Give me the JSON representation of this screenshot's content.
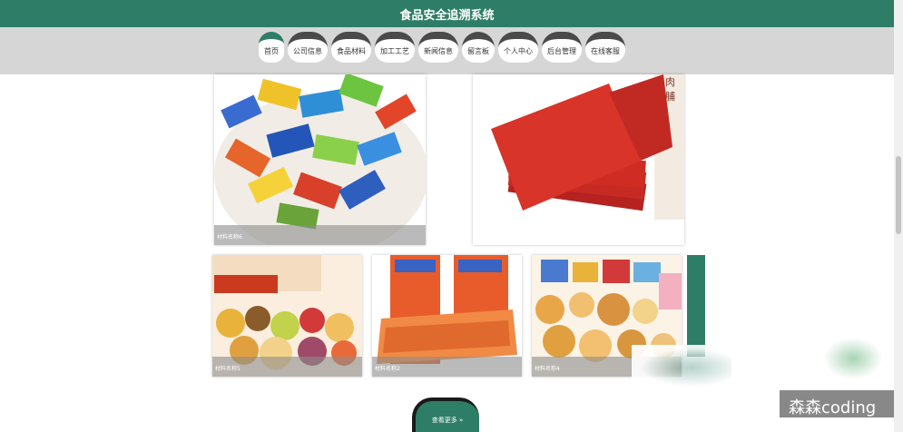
{
  "header": {
    "title": "食品安全追溯系统"
  },
  "nav": {
    "items": [
      {
        "label": "首页",
        "active": true
      },
      {
        "label": "公司信息",
        "active": false
      },
      {
        "label": "食品材料",
        "active": false
      },
      {
        "label": "加工工艺",
        "active": false
      },
      {
        "label": "新闻信息",
        "active": false
      },
      {
        "label": "留言板",
        "active": false
      },
      {
        "label": "个人中心",
        "active": false
      },
      {
        "label": "后台管理",
        "active": false
      },
      {
        "label": "在线客服",
        "active": false
      }
    ]
  },
  "materials": [
    {
      "caption": "材料名称6"
    },
    {
      "caption": ""
    },
    {
      "caption": "材料名称5"
    },
    {
      "caption": "材料名称2"
    },
    {
      "caption": "材料名称4"
    }
  ],
  "more_button": {
    "label": "查看更多 »"
  },
  "watermark": {
    "text": "森森coding"
  },
  "colors": {
    "primary": "#2e7d67",
    "nav_bg": "#d6d6d6"
  }
}
